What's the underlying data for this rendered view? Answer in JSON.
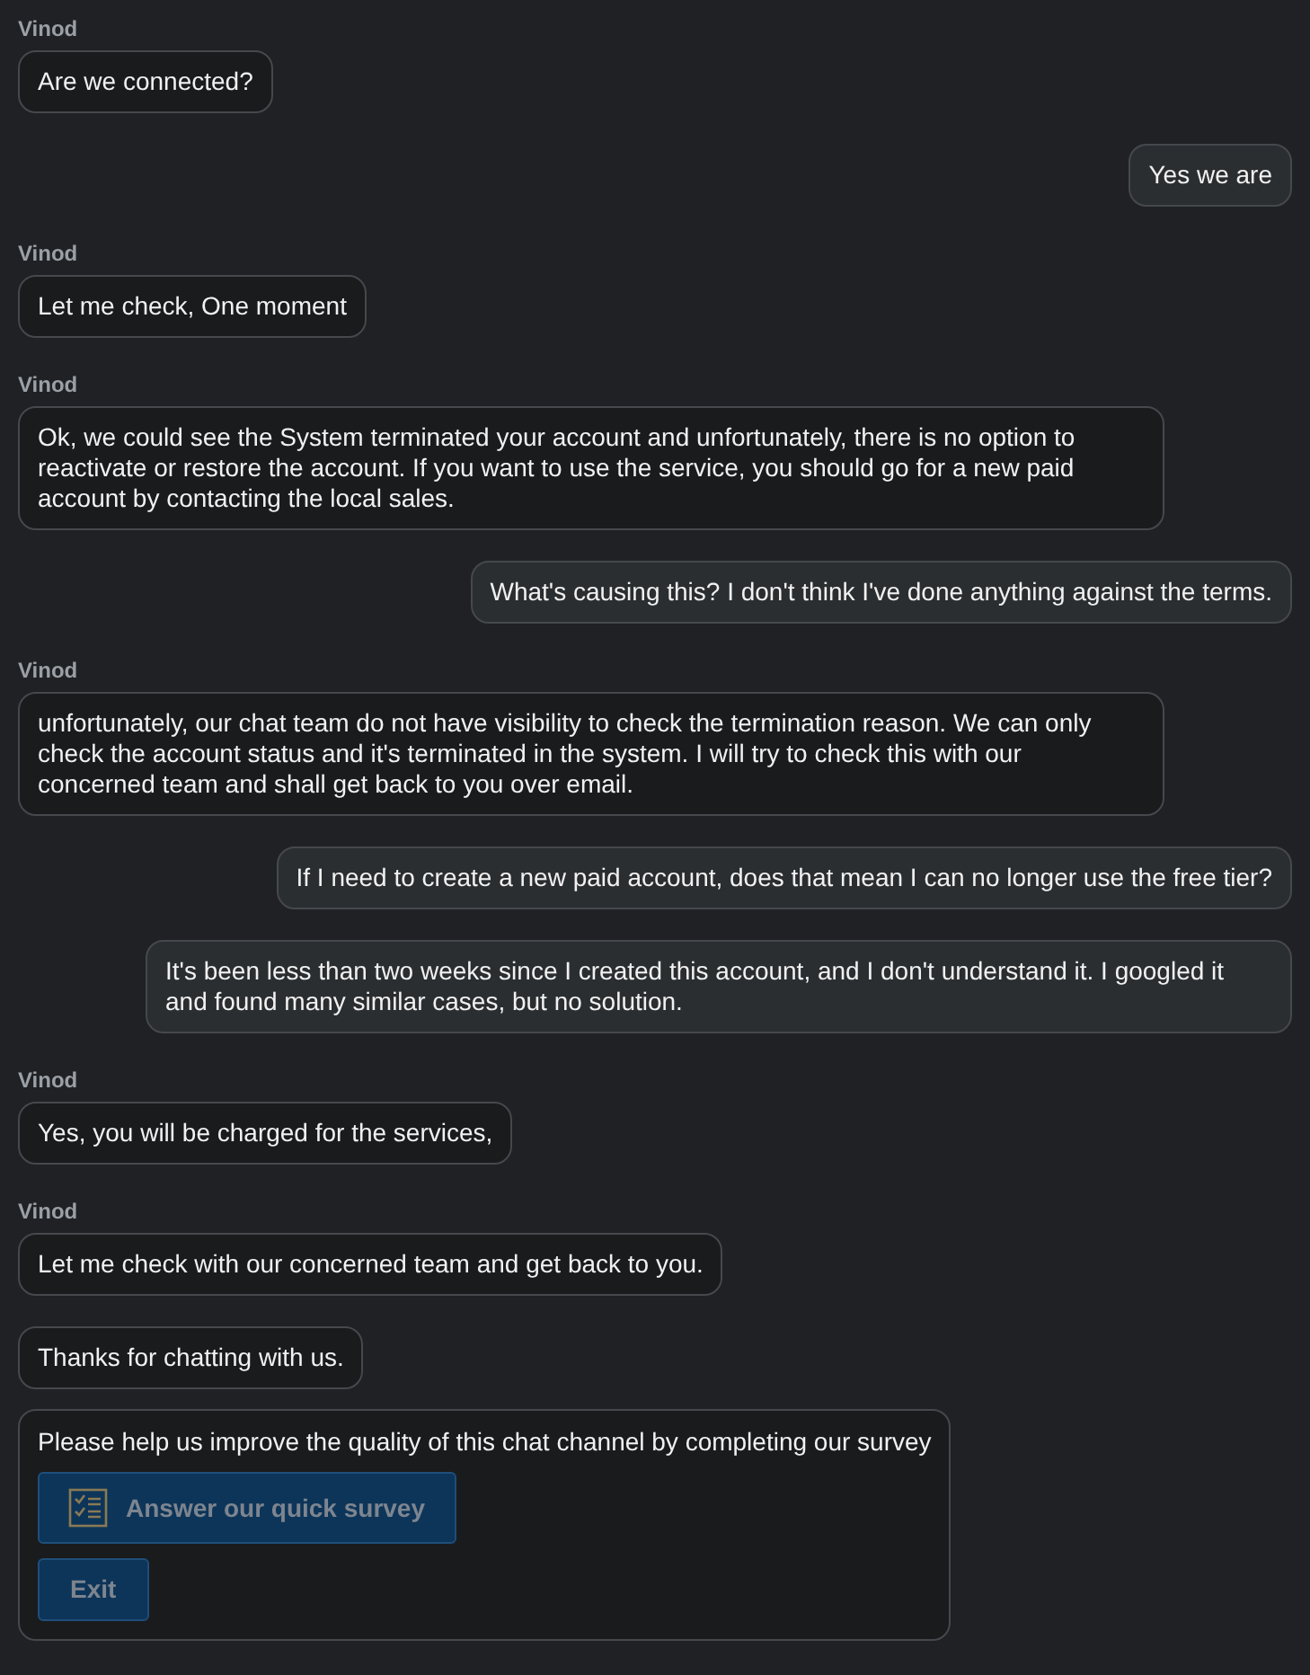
{
  "messages": [
    {
      "kind": "agent",
      "sender": "Vinod",
      "text": "Are we connected?"
    },
    {
      "kind": "user",
      "text": "Yes we are"
    },
    {
      "kind": "agent",
      "sender": "Vinod",
      "text": "Let me check, One moment"
    },
    {
      "kind": "agent",
      "sender": "Vinod",
      "text": "Ok, we could see the System terminated your account and unfortunately, there is no option to reactivate or restore the account. If you want to use the service, you should go for a new paid account by contacting the local sales."
    },
    {
      "kind": "user",
      "text": "What's causing this? I don't think I've done anything against the terms."
    },
    {
      "kind": "agent",
      "sender": "Vinod",
      "text": "unfortunately, our chat team do not have visibility to check the termination reason. We can only check the account status and it's terminated in the system. I will try to check this with our concerned team and shall get back to you over email."
    },
    {
      "kind": "user",
      "text": "If I need to create a new paid account, does that mean I can no longer use the free tier?"
    },
    {
      "kind": "user",
      "text": "It's been less than two weeks since I created this account, and I don't understand it. I googled it and found many similar cases, but no solution."
    },
    {
      "kind": "agent",
      "sender": "Vinod",
      "text": "Yes, you will be charged for the services,"
    },
    {
      "kind": "agent",
      "sender": "Vinod",
      "text": "Let me check with our concerned team and get back to you."
    },
    {
      "kind": "agent",
      "text": "Thanks for chatting with us."
    }
  ],
  "survey": {
    "prompt": "Please help us improve the quality of this chat channel by completing our survey",
    "buttons": [
      {
        "kind": "survey",
        "label": "Answer our quick survey",
        "disabled": true
      },
      {
        "kind": "exit",
        "label": "Exit",
        "disabled": true
      }
    ]
  }
}
